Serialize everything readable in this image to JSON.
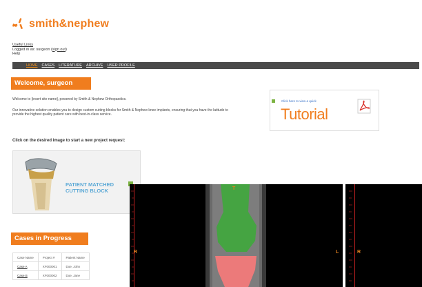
{
  "header": {
    "logo_text": "smith&nephew",
    "brand_color": "#f07d1e"
  },
  "top_links": {
    "useful_links": "Useful Links",
    "logged_in_prefix": "Logged in as: surgeon",
    "sign_out": "sign out",
    "help": "Help"
  },
  "nav": {
    "items": [
      {
        "label": "HOME",
        "active": true
      },
      {
        "label": "CASES",
        "active": false
      },
      {
        "label": "LITERATURE",
        "active": false
      },
      {
        "label": "ARCHIVE",
        "active": false
      },
      {
        "label": "USER PROFILE",
        "active": false
      }
    ]
  },
  "welcome": {
    "title": "Welcome, surgeon",
    "intro": "Welcome to [insert site name], powered by Smith & Nephew Orthopaedics.",
    "description": "Our innovative solution enables you to design custom cutting blocks for Smith & Nephew knee implants, ensuring that you have the latitude to provide the highest quality patient care with best-in-class service."
  },
  "tutorial": {
    "small_text": "Click here to view a quick",
    "big_text": "Tutorial"
  },
  "project": {
    "prompt": "Click on the desired image to start a new project request:",
    "label_line1": "PATIENT MATCHED",
    "label_line2": "CUTTING BLOCK"
  },
  "cases": {
    "title": "Cases in Progress",
    "columns": [
      "Case Name",
      "Project #",
      "Patient Name"
    ],
    "rows": [
      [
        "Case A",
        "XF000001",
        "Doe, John"
      ],
      [
        "Case B",
        "XF000002",
        "Doe, Jane"
      ]
    ]
  },
  "viewer": {
    "top_label": "T",
    "left_label": "R",
    "right_label": "L",
    "right_label2": "R",
    "femur_color": "#3fa93c",
    "tibia_color": "#f27a7a"
  }
}
